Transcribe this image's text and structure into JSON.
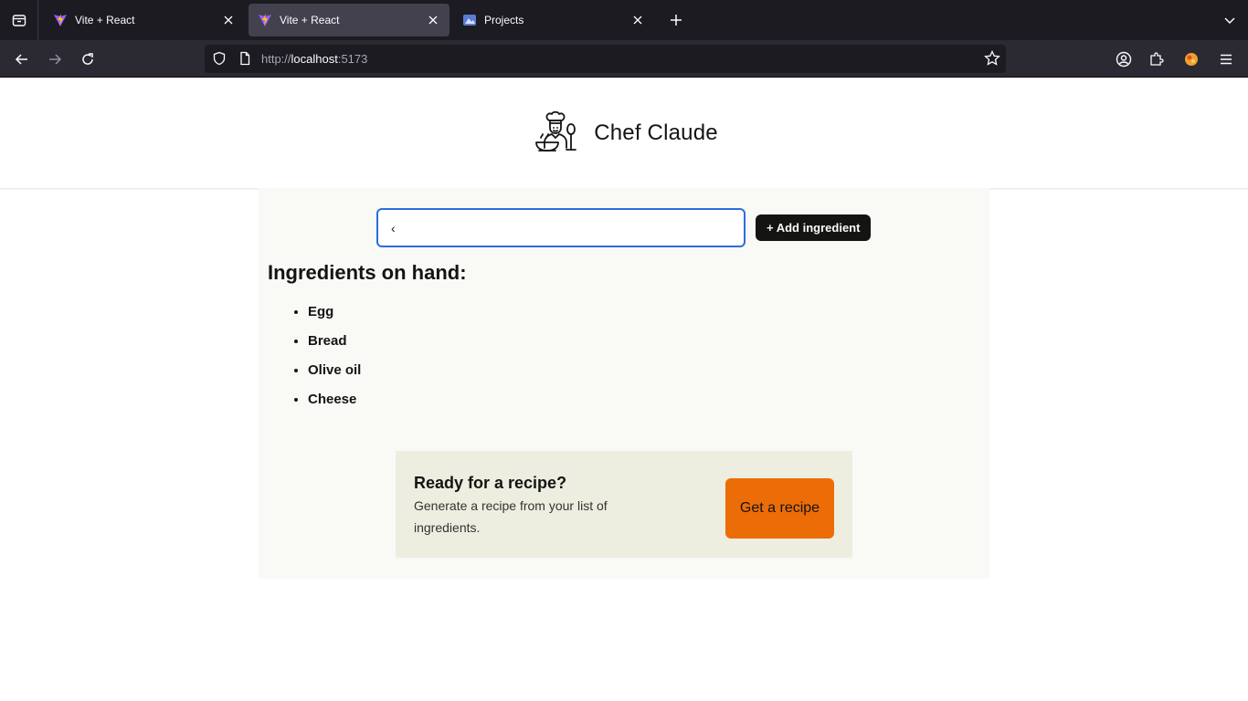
{
  "browser": {
    "tabs": [
      {
        "title": "Vite + React",
        "active": false
      },
      {
        "title": "Vite + React",
        "active": true
      },
      {
        "title": "Projects",
        "active": false
      }
    ],
    "url_scheme": "http://",
    "url_host": "localhost",
    "url_port": ":5173"
  },
  "header": {
    "brand": "Chef Claude",
    "logo_icon": "chef-icon"
  },
  "form": {
    "input_value": "‹",
    "add_label": "+ Add ingredient"
  },
  "ingredients": {
    "heading": "Ingredients on hand:",
    "items": [
      "Egg",
      "Bread",
      "Olive oil",
      "Cheese"
    ]
  },
  "cta": {
    "title": "Ready for a recipe?",
    "description": "Generate a recipe from your list of ingredients.",
    "button_label": "Get a recipe"
  },
  "colors": {
    "accent": "#ec6c08",
    "input_focus": "#2b6de0",
    "card_bg": "#edeee0"
  }
}
